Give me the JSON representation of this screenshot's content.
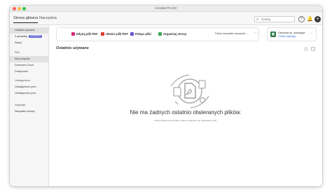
{
  "window": {
    "title": "Acrobat Pro DC"
  },
  "tabs": [
    {
      "label": "Strona główna"
    },
    {
      "label": "Narzędzia"
    }
  ],
  "search": {
    "placeholder": "Szukaj"
  },
  "sidebar": {
    "items": [
      {
        "label": "Ostatnio używane"
      },
      {
        "label": "Z gwiazdką",
        "badge": "WYPRÓBUJ"
      },
      {
        "label": "Skany"
      },
      {
        "label": "Pliki"
      },
      {
        "label": "Mój komputer"
      },
      {
        "label": "Document Cloud"
      },
      {
        "label": "Dodaj konto"
      },
      {
        "label": "Udostępnione"
      },
      {
        "label": "Udostępnione prze..."
      },
      {
        "label": "Udostępnione prze..."
      },
      {
        "label": "Inspekcja"
      },
      {
        "label": "Wszystkie umowy"
      }
    ]
  },
  "tools": {
    "items": [
      {
        "label": "Edytuj plik PDF",
        "icon": "edit-pdf-icon",
        "color": "#d8267e"
      },
      {
        "label": "Utwórz plik PDF",
        "icon": "create-pdf-icon",
        "color": "#e03a2e"
      },
      {
        "label": "Połącz pliki",
        "icon": "combine-files-icon",
        "color": "#6b4fd4"
      },
      {
        "label": "Organizuj strony",
        "icon": "organize-pages-icon",
        "color": "#3aa655"
      }
    ],
    "select_label": "Pokaż wszystkie narzędzia",
    "more": "···"
  },
  "promo": {
    "title": "Darmowe ep. skanujące",
    "link": "Pobierz aplikację",
    "icon": "scan-app-icon",
    "more": "···"
  },
  "recent": {
    "title": "Ostatnio używane",
    "empty_title": "Nie ma żadnych ostatnio otwieranych plików.",
    "empty_sub": "Tutaj pojawią się wszystkie ostatnio otwierane lub wyświetlane pliki."
  },
  "colors": {
    "accent": "#2a6fdb",
    "badge": "#6b6fd4",
    "sidebar_selected": "#e2e2e2"
  }
}
